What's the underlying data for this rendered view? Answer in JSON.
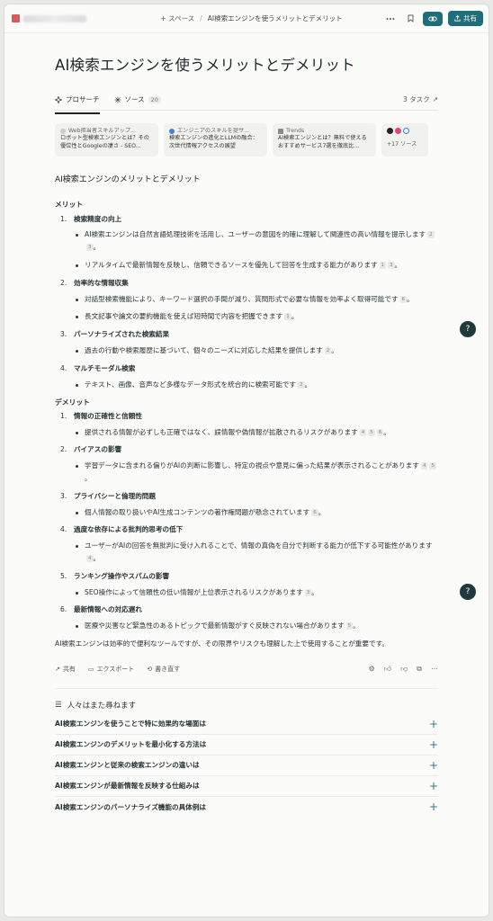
{
  "topbar": {
    "space": "+ スペース",
    "separator": "/",
    "thread_title": "AI検索エンジンを使うメリットとデメリット",
    "more_icon": "ellipsis-icon",
    "bookmark_icon": "bookmark-icon",
    "link_icon": "link-icon",
    "share_label": "共有"
  },
  "page": {
    "title": "AI検索エンジンを使うメリットとデメリット"
  },
  "tabs": {
    "perplexity": "プロサーチ",
    "sources": "ソース",
    "sources_count": "20",
    "tasks": "3 タスク"
  },
  "sources": [
    {
      "site": "Web担当者スキルアップ...",
      "desc": "ロボット型検索エンジンとは？その優位性とGoogleの凄さ - SEO..."
    },
    {
      "site": "エンジニアのスキルを提サ...",
      "desc": "検索エンジンの進化とLLMの融合：次世代情報アクセスの展望"
    },
    {
      "site": "Trends",
      "desc": "AI検索エンジンとは？無料で使えるおすすめサービス7選を徹底比..."
    }
  ],
  "sources_more": "+17 ソース",
  "answer": {
    "heading": "AI検索エンジンのメリットとデメリット",
    "merit_title": "メリット",
    "merits": [
      {
        "num": "1.",
        "title": "検索精度の向上",
        "bullets": [
          {
            "text": "AI検索エンジンは自然言語処理技術を活用し、ユーザーの意図を的確に理解して関連性の高い情報を提示します",
            "cites": [
              "2",
              "3"
            ]
          },
          {
            "text": "リアルタイムで最新情報を反映し、信頼できるソースを優先して回答を生成する能力があります",
            "cites": [
              "1",
              "3"
            ]
          }
        ]
      },
      {
        "num": "2.",
        "title": "効率的な情報収集",
        "bullets": [
          {
            "text": "対話型検索機能により、キーワード選択の手間が減り、質問形式で必要な情報を効率よく取得可能です",
            "cites": [
              "6"
            ]
          },
          {
            "text": "長文記事や論文の要約機能を使えば短時間で内容を把握できます",
            "cites": [
              "1"
            ]
          }
        ]
      },
      {
        "num": "3.",
        "title": "パーソナライズされた検索結果",
        "bullets": [
          {
            "text": "過去の行動や検索履歴に基づいて、個々のニーズに対応した結果を提供します",
            "cites": [
              "2"
            ]
          }
        ]
      },
      {
        "num": "4.",
        "title": "マルチモーダル検索",
        "bullets": [
          {
            "text": "テキスト、画像、音声など多様なデータ形式を統合的に検索可能です",
            "cites": [
              "2"
            ]
          }
        ]
      }
    ],
    "demerit_title": "デメリット",
    "demerits": [
      {
        "num": "1.",
        "title": "情報の正確性と信頼性",
        "bullets": [
          {
            "text": "提供される情報が必ずしも正確ではなく、誤情報や偽情報が拡散されるリスクがあります",
            "cites": [
              "4",
              "5",
              "6"
            ]
          }
        ]
      },
      {
        "num": "2.",
        "title": "バイアスの影響",
        "bullets": [
          {
            "text": "学習データに含まれる偏りがAIの判断に影響し、特定の視点や意見に偏った結果が表示されることがあります",
            "cites": [
              "4",
              "5"
            ]
          }
        ]
      },
      {
        "num": "3.",
        "title": "プライバシーと倫理的問題",
        "bullets": [
          {
            "text": "個人情報の取り扱いやAI生成コンテンツの著作権問題が懸念されています",
            "cites": [
              "6"
            ]
          }
        ]
      },
      {
        "num": "4.",
        "title": "過度な依存による批判的思考の低下",
        "bullets": [
          {
            "text": "ユーザーがAIの回答を無批判に受け入れることで、情報の真偽を自分で判断する能力が低下する可能性があります",
            "cites": [
              "4"
            ]
          }
        ]
      },
      {
        "num": "5.",
        "title": "ランキング操作やスパムの影響",
        "bullets": [
          {
            "text": "SEO操作によって信頼性の低い情報が上位表示されるリスクがあります",
            "cites": [
              "3"
            ]
          }
        ]
      },
      {
        "num": "6.",
        "title": "最新情報への対応遅れ",
        "bullets": [
          {
            "text": "医療や災害など緊急性のあるトピックで最新情報がすぐ反映されない場合があります",
            "cites": [
              "5"
            ]
          }
        ]
      }
    ],
    "conclusion": "AI検索エンジンは効率的で便利なツールですが、その限界やリスクも理解した上で使用することが重要です。"
  },
  "actions": {
    "share": "共有",
    "export": "エクスポート",
    "rewrite": "書き直す"
  },
  "related": {
    "title": "人々はまた尋ねます",
    "items": [
      "AI検索エンジンを使うことで特に効果的な場面は",
      "AI検索エンジンのデメリットを最小化する方法は",
      "AI検索エンジンと従来の検索エンジンの違いは",
      "AI検索エンジンが最新情報を反映する仕組みは",
      "AI検索エンジンのパーソナライズ機能の具体例は"
    ]
  },
  "help_label": "?",
  "colors": {
    "accent": "#1f6f7a",
    "background": "#fbfbf9"
  }
}
